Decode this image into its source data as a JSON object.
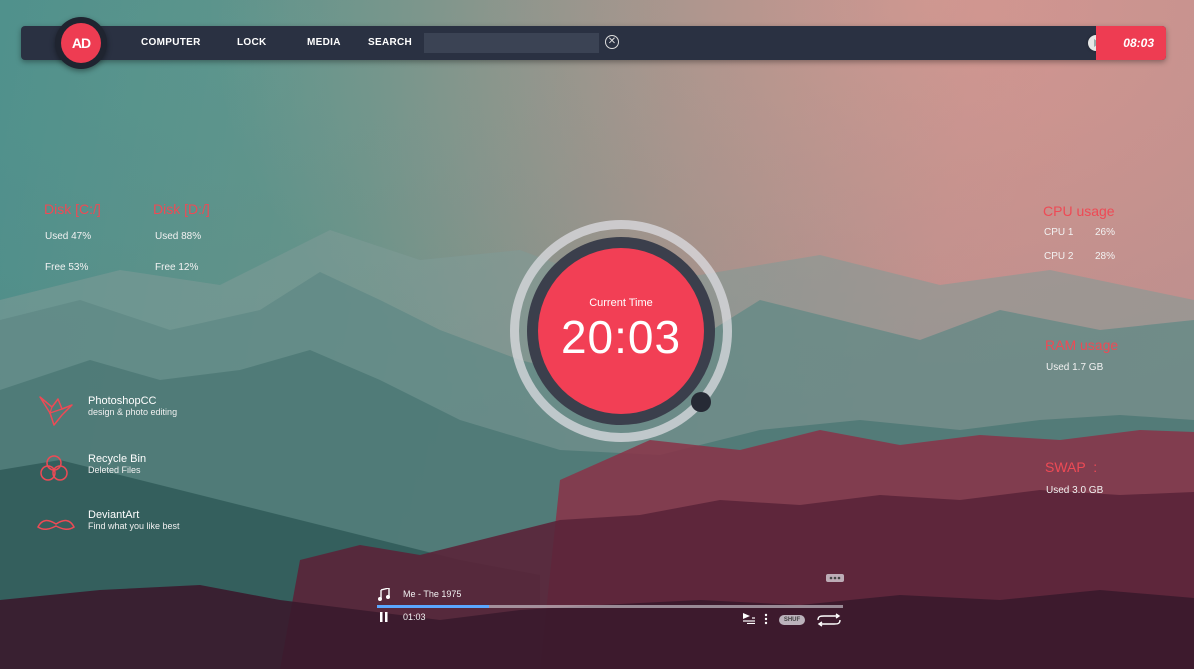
{
  "topbar": {
    "logo_text": "AD",
    "nav": [
      "COMPUTER",
      "LOCK",
      "MEDIA",
      "SEARCH"
    ],
    "search_placeholder": "",
    "clock": "08:03"
  },
  "disks": [
    {
      "title": "Disk [C:/]",
      "used": "Used 47%",
      "free": "Free 53%"
    },
    {
      "title": "Disk [D:/]",
      "used": "Used 88%",
      "free": "Free 12%"
    }
  ],
  "clock": {
    "label": "Current Time",
    "time": "20:03"
  },
  "cpu": {
    "title": "CPU usage",
    "rows": [
      {
        "label": "CPU 1",
        "value": "26%"
      },
      {
        "label": "CPU 2",
        "value": "28%"
      }
    ]
  },
  "ram": {
    "title": "RAM usage",
    "used": "Used 1.7 GB"
  },
  "swap": {
    "title": "SWAP  :",
    "used": "Used 3.0 GB"
  },
  "shortcuts": [
    {
      "title": "PhotoshopCC",
      "subtitle": "design & photo editing",
      "icon": "origami-bird-icon"
    },
    {
      "title": "Recycle Bin",
      "subtitle": "Deleted Files",
      "icon": "recycle-icon"
    },
    {
      "title": "DeviantArt",
      "subtitle": "Find what you like best",
      "icon": "mustache-icon"
    }
  ],
  "player": {
    "track": "Me - The 1975",
    "elapsed": "01:03",
    "progress": 0.24,
    "shuffle_label": "SHUF"
  },
  "colors": {
    "accent": "#ee3c52",
    "bar": "#2a3142",
    "progress": "#5aa7ff"
  }
}
